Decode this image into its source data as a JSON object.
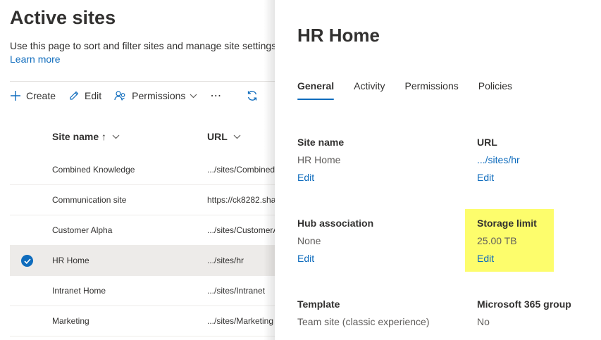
{
  "page": {
    "title": "Active sites",
    "description": "Use this page to sort and filter sites and manage site settings",
    "learn_more": "Learn more"
  },
  "commands": {
    "create": "Create",
    "edit": "Edit",
    "permissions": "Permissions",
    "more": "⋯"
  },
  "grid": {
    "headers": {
      "site_name": "Site name ↑",
      "url": "URL"
    },
    "rows": [
      {
        "name": "Combined Knowledge",
        "url": ".../sites/Combined",
        "selected": false
      },
      {
        "name": "Communication site",
        "url": "https://ck8282.sha",
        "selected": false
      },
      {
        "name": "Customer Alpha",
        "url": ".../sites/CustomerA",
        "selected": false
      },
      {
        "name": "HR Home",
        "url": ".../sites/hr",
        "selected": true
      },
      {
        "name": "Intranet Home",
        "url": ".../sites/Intranet",
        "selected": false
      },
      {
        "name": "Marketing",
        "url": ".../sites/Marketing",
        "selected": false
      }
    ]
  },
  "panel": {
    "title": "HR Home",
    "tabs": [
      "General",
      "Activity",
      "Permissions",
      "Policies"
    ],
    "active_tab": "General",
    "fields": {
      "site_name": {
        "label": "Site name",
        "value": "HR Home",
        "edit": "Edit"
      },
      "url": {
        "label": "URL",
        "value": ".../sites/hr",
        "edit": "Edit"
      },
      "hub_association": {
        "label": "Hub association",
        "value": "None",
        "edit": "Edit"
      },
      "storage_limit": {
        "label": "Storage limit",
        "value": "25.00 TB",
        "edit": "Edit"
      },
      "template": {
        "label": "Template",
        "value": "Team site (classic experience)"
      },
      "m365_group": {
        "label": "Microsoft 365 group",
        "value": "No"
      }
    }
  },
  "colors": {
    "accent": "#0f6cbd",
    "highlight": "#fdfd6c",
    "selected_row": "#edebe9"
  }
}
